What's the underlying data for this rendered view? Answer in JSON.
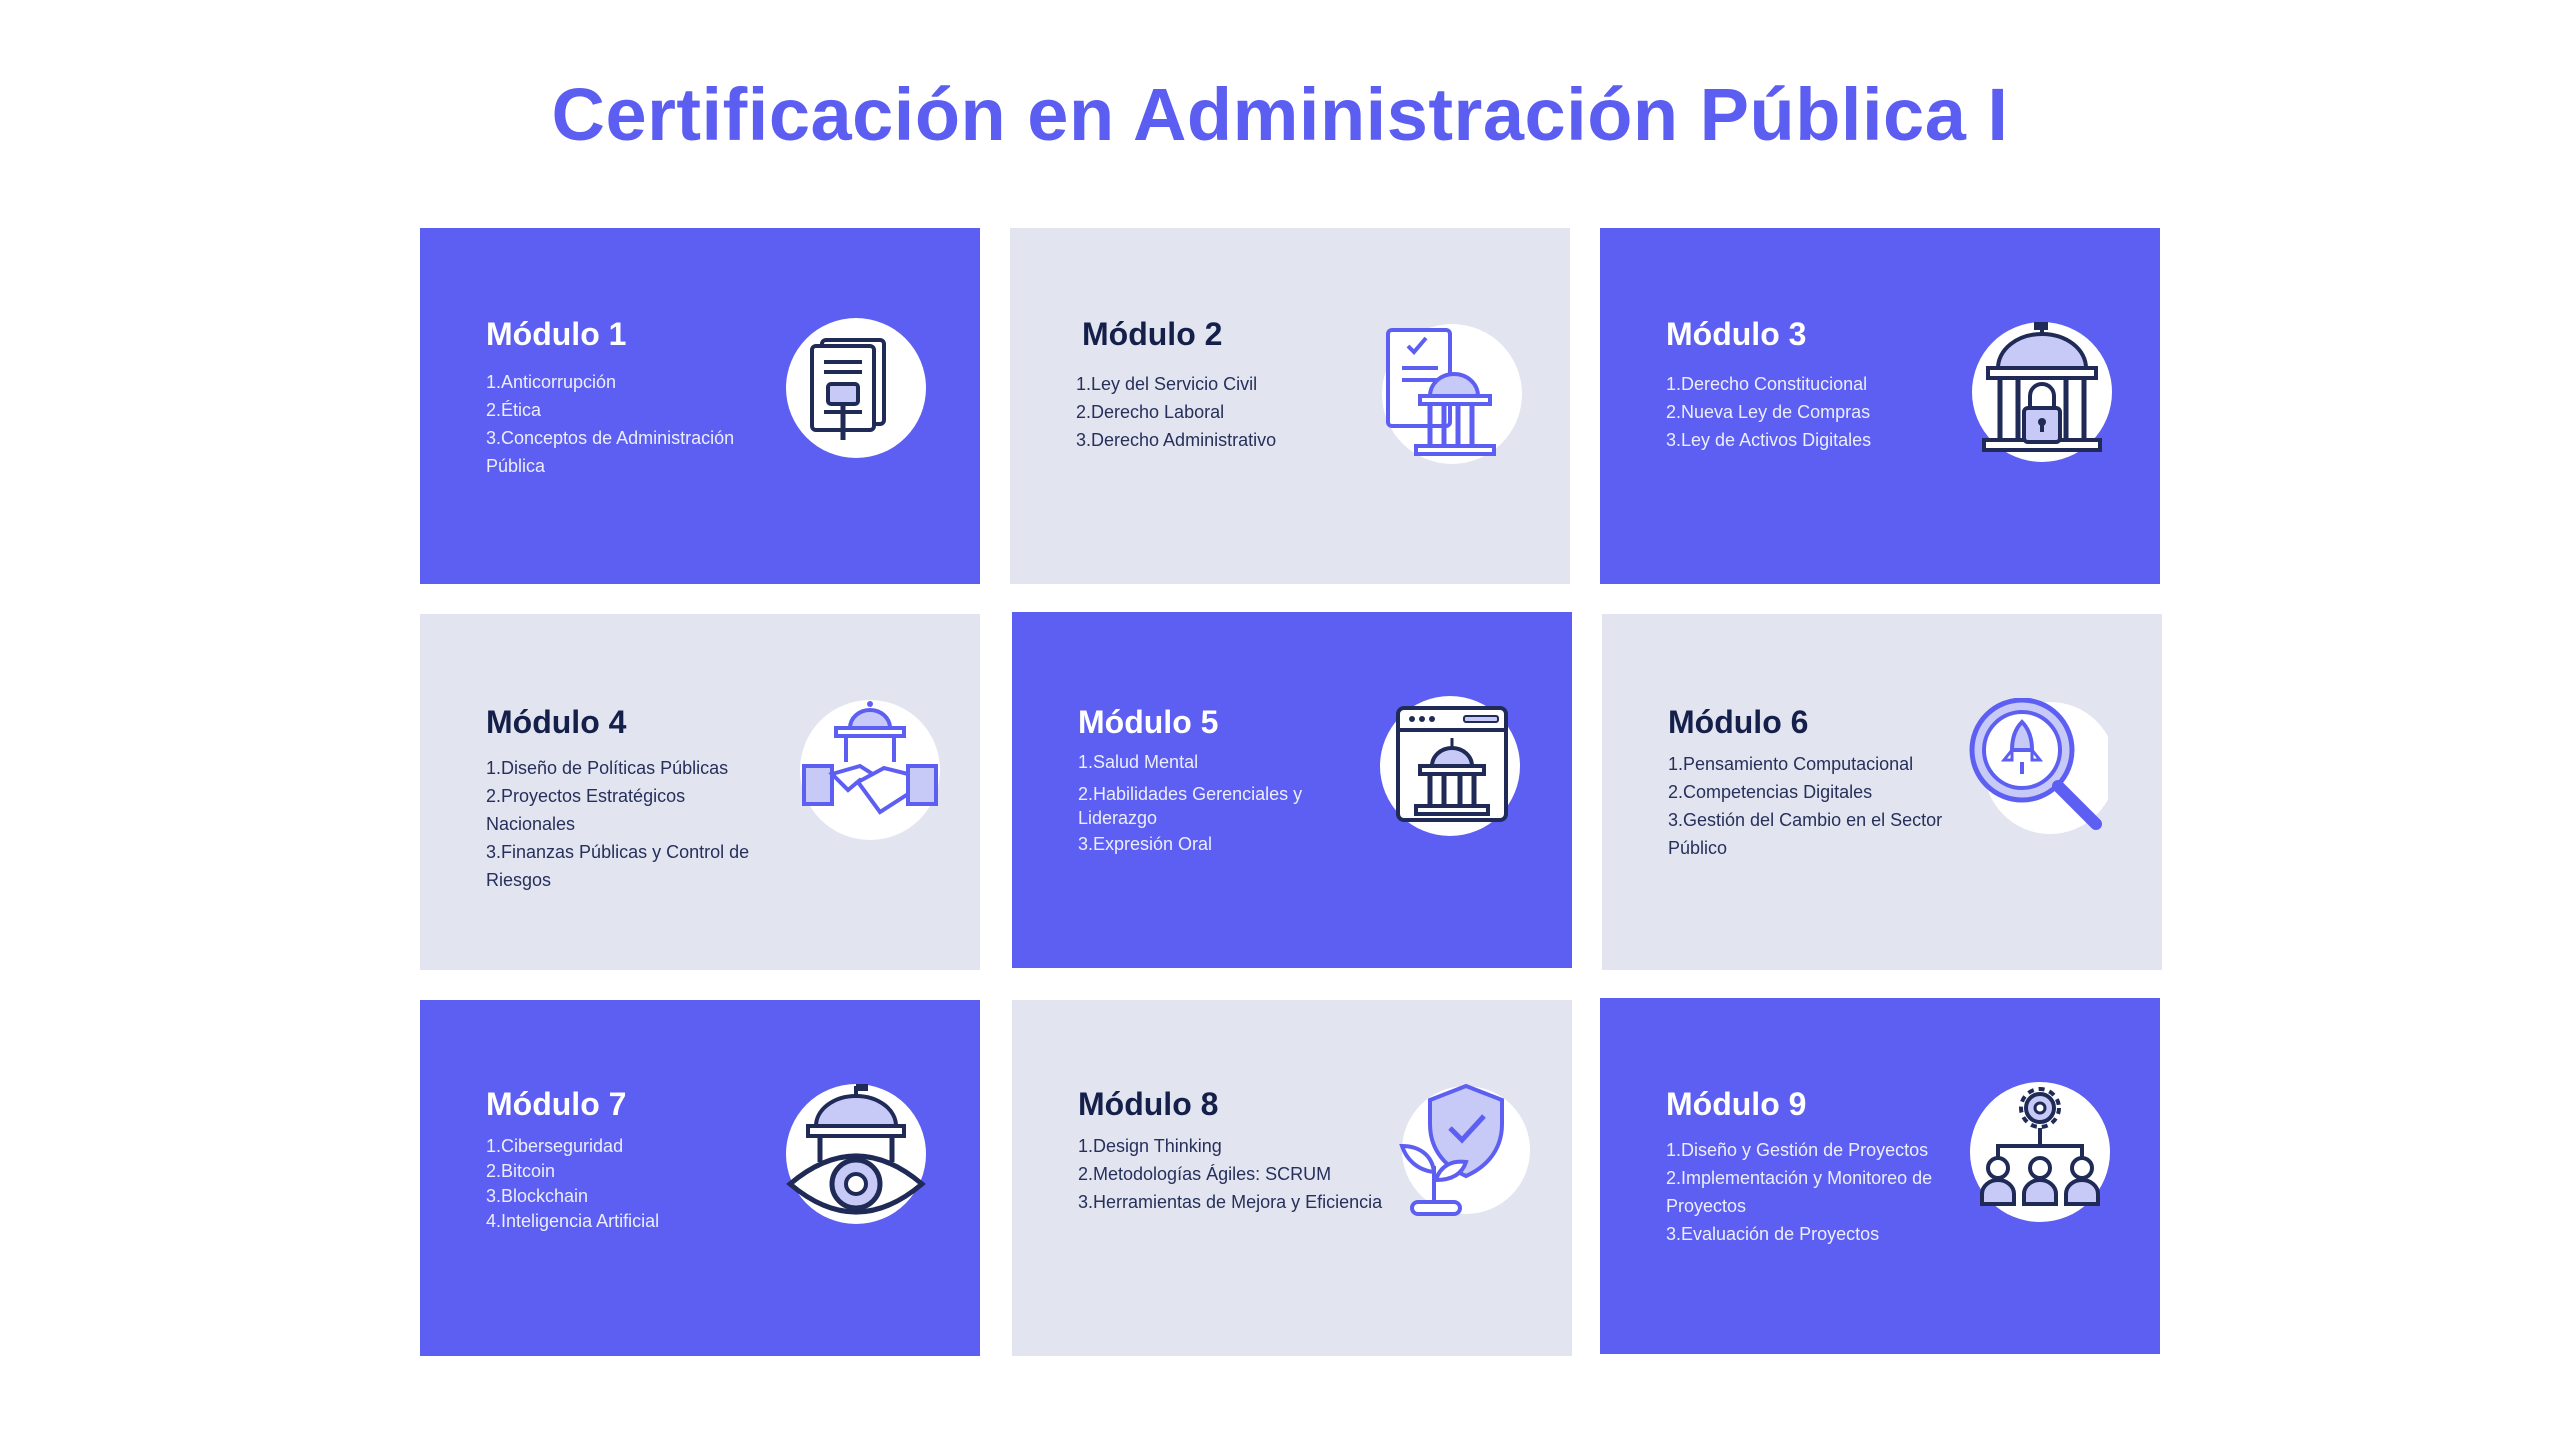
{
  "title": "Certificación en Administración Pública I",
  "colors": {
    "accent": "#5d5ff2",
    "light_bg": "#e2e4f0",
    "title": "#5b5ef0",
    "icon_stroke": "#1f2a56"
  },
  "modules": [
    {
      "name": "Módulo 1",
      "items": [
        "1.Anticorrupción",
        "2.Ética",
        "3.Conceptos de Administración Pública"
      ],
      "icon": "document-gavel-icon"
    },
    {
      "name": "Módulo 2",
      "items": [
        "1.Ley del Servicio Civil",
        "2.Derecho Laboral",
        "3.Derecho Administrativo"
      ],
      "icon": "law-scroll-building-icon"
    },
    {
      "name": "Módulo 3",
      "items": [
        "1.Derecho Constitucional",
        "2.Nueva Ley de Compras",
        "3.Ley de Activos Digitales"
      ],
      "icon": "building-lock-icon"
    },
    {
      "name": "Módulo 4",
      "items": [
        "1.Diseño de Políticas Públicas",
        "2.Proyectos Estratégicos Nacionales",
        "3.Finanzas Públicas y Control de Riesgos"
      ],
      "icon": "handshake-building-icon"
    },
    {
      "name": "Módulo 5",
      "items": [
        "1.Salud Mental",
        "2.Habilidades Gerenciales y Liderazgo",
        "3.Expresión Oral"
      ],
      "icon": "browser-building-icon"
    },
    {
      "name": "Módulo 6",
      "items": [
        "1.Pensamiento Computacional",
        "2.Competencias Digitales",
        "3.Gestión del Cambio en el Sector Público"
      ],
      "icon": "magnifier-rocket-icon"
    },
    {
      "name": "Módulo 7",
      "items": [
        "1.Ciberseguridad",
        "2.Bitcoin",
        "3.Blockchain",
        "4.Inteligencia Artificial"
      ],
      "icon": "eye-building-icon"
    },
    {
      "name": "Módulo 8",
      "items": [
        "1.Design Thinking",
        "2.Metodologías Ágiles: SCRUM",
        "3.Herramientas de Mejora y Eficiencia"
      ],
      "icon": "shield-plant-icon"
    },
    {
      "name": "Módulo 9",
      "items": [
        "1.Diseño y Gestión de Proyectos",
        "2.Implementación y Monitoreo de Proyectos",
        "3.Evaluación de Proyectos"
      ],
      "icon": "team-gear-icon"
    }
  ]
}
